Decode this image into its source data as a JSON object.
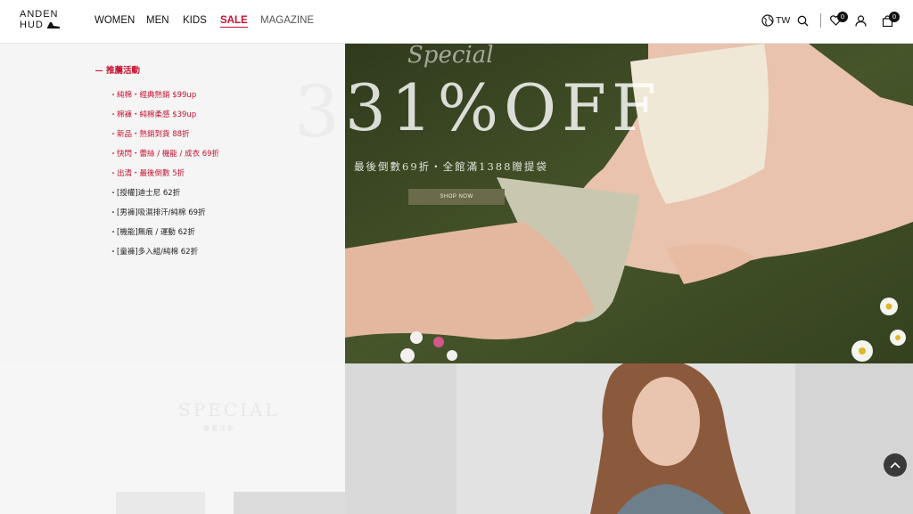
{
  "brand": {
    "logo_line1": "ANDEN",
    "logo_line2": "HUD"
  },
  "nav": {
    "items": [
      {
        "label": "WOMEN"
      },
      {
        "label": "MEN"
      },
      {
        "label": "KIDS"
      },
      {
        "label": "SALE"
      },
      {
        "label": "MAGAZINE"
      }
    ]
  },
  "header_right": {
    "region_label": "TW",
    "wishlist_count": "0",
    "cart_count": "0",
    "icons": [
      "globe-icon",
      "search-icon",
      "heart-icon",
      "user-icon",
      "bag-icon"
    ]
  },
  "menu": {
    "heading": "推薦活動",
    "items": [
      {
        "label": "純棉・經典熱銷 $99up",
        "color": "#c8102e"
      },
      {
        "label": "棉褲・純棉柔感 $39up",
        "color": "#c8102e"
      },
      {
        "label": "新品・熱銷到貨 88折",
        "color": "#c8102e"
      },
      {
        "label": "快閃・蕾絲 / 機能 / 成衣 69折",
        "color": "#c8102e"
      },
      {
        "label": "出清・最後倒數 5折",
        "color": "#c8102e"
      },
      {
        "label": "[授權]迪士尼 62折",
        "color": "#222222"
      },
      {
        "label": "[男褲]吸濕排汗/純棉 69折",
        "color": "#222222"
      },
      {
        "label": "[機能]無痕 / 運動 62折",
        "color": "#222222"
      },
      {
        "label": "[童褲]多入組/純棉 62折",
        "color": "#222222"
      }
    ]
  },
  "hero": {
    "script_text": "Special",
    "headline": "31%OFF",
    "ghost_text": "31%OFF",
    "subline": "最後倒數69折・全館滿1388贈提袋",
    "button_label": "SHOP NOW"
  },
  "section2": {
    "title": "SPECIAL",
    "subtitle": "優惠活動"
  },
  "colors": {
    "accent_red": "#c8102e",
    "hero_button": "#6b6a4a",
    "grass": "#3e4a25"
  }
}
